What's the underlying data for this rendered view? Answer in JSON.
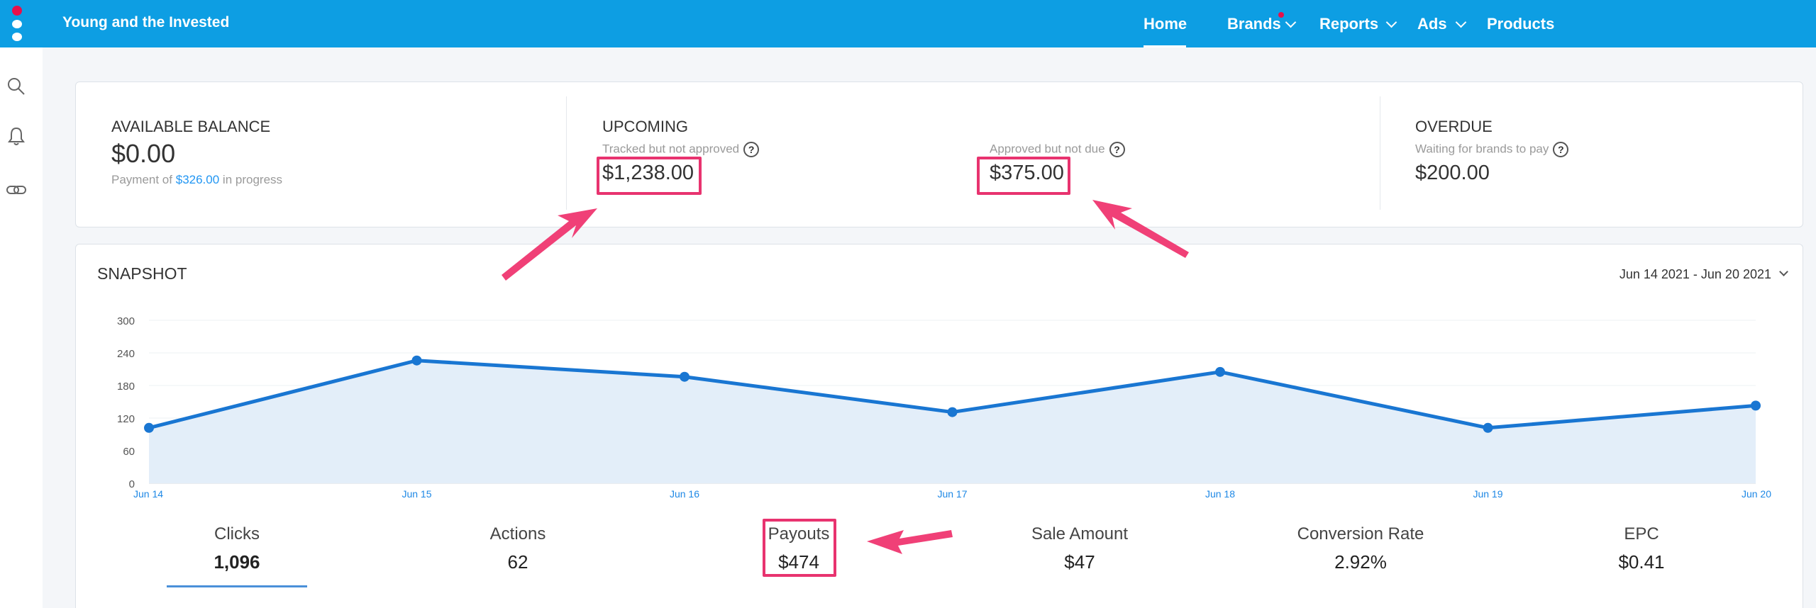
{
  "header": {
    "app_name": "Young and the Invested",
    "nav": [
      {
        "label": "Home",
        "active": true
      },
      {
        "label": "Brands",
        "dropdown": true,
        "notification": true
      },
      {
        "label": "Reports",
        "dropdown": true
      },
      {
        "label": "Ads",
        "dropdown": true
      },
      {
        "label": "Products"
      }
    ]
  },
  "sidebar": {
    "icons": [
      "search-icon",
      "bell-icon",
      "link-icon"
    ]
  },
  "balance": {
    "available": {
      "label": "AVAILABLE BALANCE",
      "amount": "$0.00",
      "note_prefix": "Payment of",
      "note_link": "$326.00",
      "note_suffix": "in progress"
    },
    "upcoming": {
      "label": "UPCOMING",
      "tracked_label": "Tracked but not approved",
      "tracked_amount": "$1,238.00",
      "approved_label": "Approved but not due",
      "approved_amount": "$375.00"
    },
    "overdue": {
      "label": "OVERDUE",
      "sub_label": "Waiting for brands to pay",
      "amount": "$200.00"
    },
    "help_glyph": "?"
  },
  "snapshot": {
    "title": "SNAPSHOT",
    "date_range": "Jun 14 2021 - Jun 20 2021",
    "metrics": [
      {
        "label": "Clicks",
        "value": "1,096",
        "active": true
      },
      {
        "label": "Actions",
        "value": "62"
      },
      {
        "label": "Payouts",
        "value": "$474"
      },
      {
        "label": "Sale Amount",
        "value": "$47"
      },
      {
        "label": "Conversion Rate",
        "value": "2.92%"
      },
      {
        "label": "EPC",
        "value": "$0.41"
      }
    ]
  },
  "chart_data": {
    "type": "area",
    "categories": [
      "Jun 14",
      "Jun 15",
      "Jun 16",
      "Jun 17",
      "Jun 18",
      "Jun 19",
      "Jun 20"
    ],
    "values": [
      102,
      226,
      196,
      131,
      205,
      102,
      143
    ],
    "yticks": [
      0,
      60,
      120,
      180,
      240,
      300
    ],
    "ylim": [
      0,
      300
    ],
    "grid": true,
    "line_color": "#1976d2",
    "fill_color": "#e3eef9"
  },
  "colors": {
    "topbar": "#0d9ee3",
    "highlight": "#e8336f",
    "accent_red": "#e8104b"
  }
}
